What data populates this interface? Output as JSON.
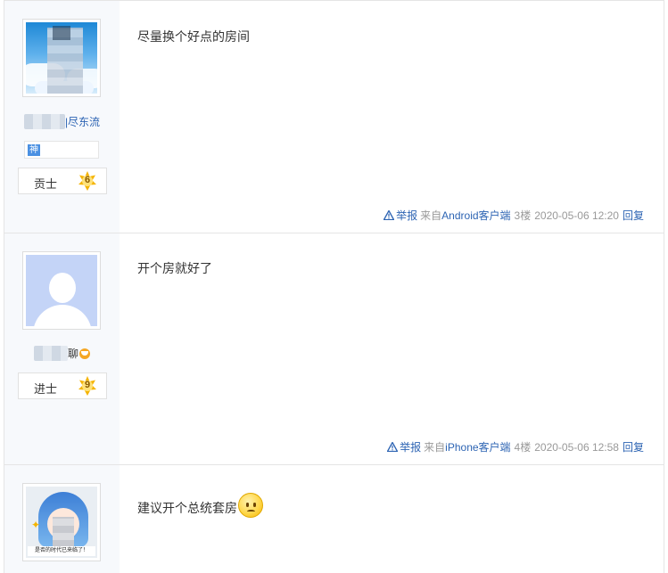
{
  "posts": [
    {
      "username": "|尽东流",
      "tag": "神",
      "level_name": "贡士",
      "level_num": "6",
      "content": "尽量换个好点的房间",
      "report_label": "举报",
      "source_prefix": "来自",
      "client": "Android客户端",
      "floor": "3楼",
      "time": "2020-05-06 12:20",
      "reply_label": "回复"
    },
    {
      "username": "聊",
      "level_name": "进士",
      "level_num": "9",
      "content": "开个房就好了",
      "report_label": "举报",
      "source_prefix": "来自",
      "client": "iPhone客户端",
      "floor": "4楼",
      "time": "2020-05-06 12:58",
      "reply_label": "回复"
    },
    {
      "avatar_caption": "是否的时代已来临了！",
      "content": "建议开个总统套房"
    }
  ],
  "colors": {
    "link": "#2d64b3",
    "sidebar_bg": "#f7f9fc",
    "meta_gray": "#999999",
    "level_badge": "#f5b400"
  },
  "icons": [
    "warning-icon",
    "level-badge-icon",
    "smile-icon",
    "sad-face-emoji-icon"
  ]
}
